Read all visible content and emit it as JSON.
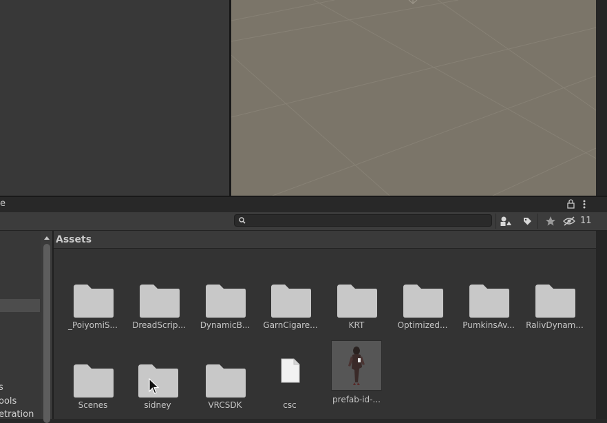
{
  "scene": {
    "background": "#7b7569",
    "grid_color": "#8a8478"
  },
  "project_window": {
    "tab_label": "e",
    "hidden_count": "11",
    "icons": {
      "lock": "lock-icon",
      "menu": "kebab-menu-icon",
      "search": "search-icon",
      "filter_type": "filter-by-type-icon",
      "filter_label": "filter-by-label-icon",
      "favorite": "star-icon",
      "hidden_packages": "eye-slash-icon"
    }
  },
  "tree": {
    "items": [
      {
        "label": "s"
      },
      {
        "label": "ools"
      },
      {
        "label": "etration"
      }
    ]
  },
  "assets": {
    "title": "Assets",
    "items": [
      {
        "label": "_PoiyomiS...",
        "type": "folder"
      },
      {
        "label": "DreadScrip...",
        "type": "folder"
      },
      {
        "label": "DynamicB...",
        "type": "folder"
      },
      {
        "label": "GarnCigare...",
        "type": "folder"
      },
      {
        "label": "KRT",
        "type": "folder"
      },
      {
        "label": "Optimized...",
        "type": "folder"
      },
      {
        "label": "PumkinsAv...",
        "type": "folder"
      },
      {
        "label": "RalivDynam...",
        "type": "folder"
      },
      {
        "label": "Scenes",
        "type": "folder"
      },
      {
        "label": "sidney",
        "type": "folder"
      },
      {
        "label": "VRCSDK",
        "type": "folder"
      },
      {
        "label": "csc",
        "type": "file"
      },
      {
        "label": "prefab-id-...",
        "type": "prefab"
      }
    ]
  }
}
